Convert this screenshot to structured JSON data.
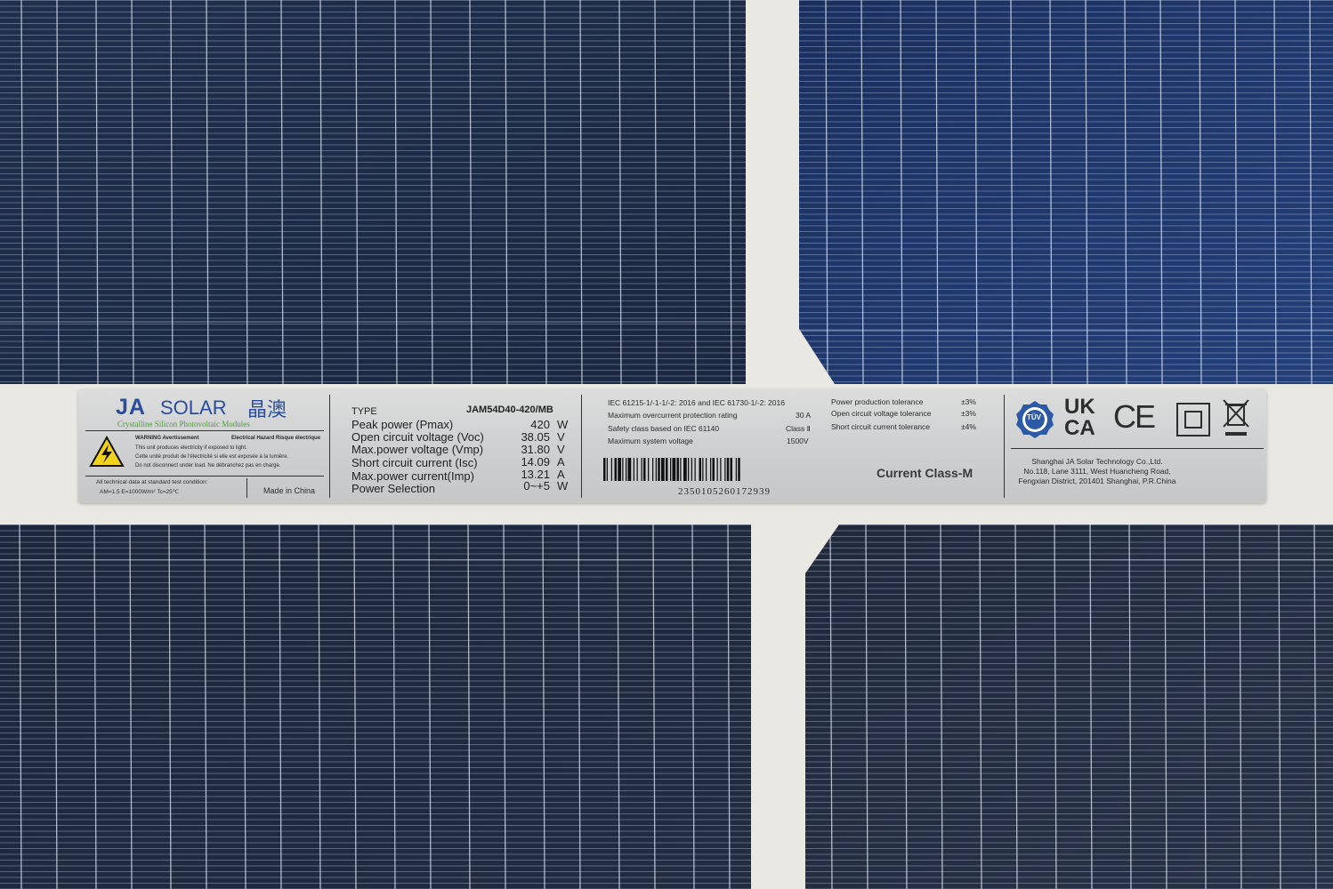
{
  "brand": {
    "ja": "JA",
    "solar": "SOLAR",
    "chinese": "晶澳",
    "tagline": "Crystalline Silicon Photovoltaic Modules",
    "color": "#2b4d9b"
  },
  "warning": {
    "title": "WARNING Avertissement",
    "hazard": "Electrical Hazard  Risque électrique",
    "lines": [
      "This unit produces electricity if exposed to light.",
      "Cette unité produit de l'électricité si elle est exposée à la lumière.",
      "Do not disconnect under load.  Ne débranchez pas en charge."
    ]
  },
  "std_condition": {
    "line1": "All technical data at standard test condition:",
    "line2": "AM=1.5  E=1000W/m²  Tc=25℃"
  },
  "made_in": "Made in China",
  "type_label": "TYPE",
  "model": "JAM54D40-420/MB",
  "specs": [
    {
      "label": "Peak power (Pmax)",
      "value": "420",
      "unit": "W"
    },
    {
      "label": "Open circuit voltage (Voc)",
      "value": "38.05",
      "unit": "V"
    },
    {
      "label": "Max.power voltage (Vmp)",
      "value": "31.80",
      "unit": "V"
    },
    {
      "label": "Short circuit current (Isc)",
      "value": "14.09",
      "unit": "A"
    },
    {
      "label": "Max.power current(Imp)",
      "value": "13.21",
      "unit": "A"
    },
    {
      "label": "Power Selection",
      "value": "0~+5",
      "unit": "W"
    }
  ],
  "certs": {
    "standard": "IEC 61215-1/-1-1/-2: 2016  and  IEC 61730-1/-2: 2016",
    "rows": [
      {
        "label": "Maximum overcurrent protection  rating",
        "value": "30 A"
      },
      {
        "label": "Safety class based on IEC 61140",
        "value": "Class Ⅱ"
      },
      {
        "label": "Maximum system voltage",
        "value": "1500V"
      }
    ]
  },
  "tolerances": [
    {
      "label": "Power production tolerance",
      "value": "±3%"
    },
    {
      "label": "Open circuit voltage tolerance",
      "value": "±3%"
    },
    {
      "label": "Short circuit current  tolerance",
      "value": "±4%"
    }
  ],
  "current_class": "Current Class-M",
  "serial": "2350105260172939",
  "marks": {
    "tuv": "TÜV",
    "ukca_top": "UK",
    "ukca_bottom": "CA",
    "ce": "CE"
  },
  "address": [
    "Shanghai JA Solar Technology Co.,Ltd.",
    "No.118, Lane 3111, West Huancheng Road,",
    "Fengxian District, 201401 Shanghai, P.R.China"
  ]
}
